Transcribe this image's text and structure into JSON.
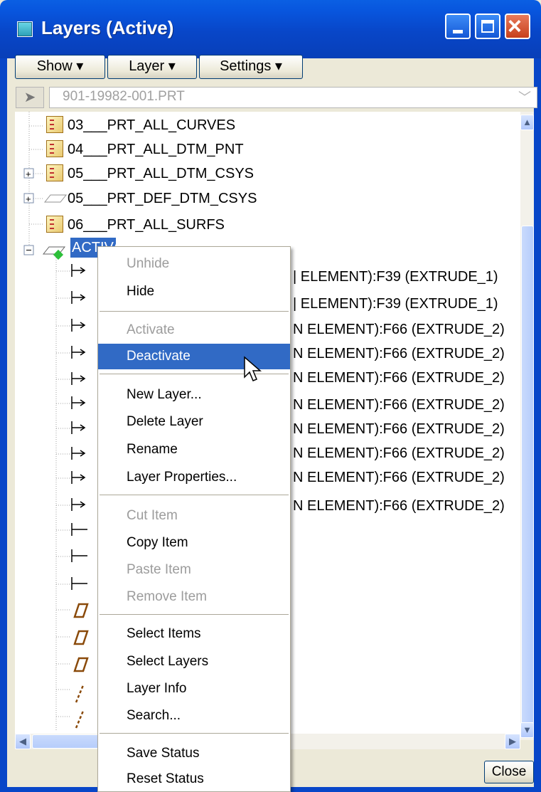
{
  "window": {
    "title": "Layers (Active)"
  },
  "menubar": {
    "show_label": "Show ▾",
    "layer_label": "Layer ▾",
    "settings_label": "Settings ▾"
  },
  "model_combo": {
    "value": "901-19982-001.PRT"
  },
  "tree": {
    "items": [
      {
        "label": "03___PRT_ALL_CURVES"
      },
      {
        "label": "04___PRT_ALL_DTM_PNT"
      },
      {
        "label": "05___PRT_ALL_DTM_CSYS"
      },
      {
        "label": "05___PRT_DEF_DTM_CSYS"
      },
      {
        "label": "06___PRT_ALL_SURFS"
      },
      {
        "label": "ACTIVATE"
      }
    ],
    "children": [
      {
        "label": "| ELEMENT):F39 (EXTRUDE_1)"
      },
      {
        "label": "| ELEMENT):F39 (EXTRUDE_1)"
      },
      {
        "label": "N ELEMENT):F66 (EXTRUDE_2)"
      },
      {
        "label": "N ELEMENT):F66 (EXTRUDE_2)"
      },
      {
        "label": "N ELEMENT):F66 (EXTRUDE_2)"
      },
      {
        "label": "N ELEMENT):F66 (EXTRUDE_2)"
      },
      {
        "label": "N ELEMENT):F66 (EXTRUDE_2)"
      },
      {
        "label": "N ELEMENT):F66 (EXTRUDE_2)"
      },
      {
        "label": "N ELEMENT):F66 (EXTRUDE_2)"
      },
      {
        "label": "N ELEMENT):F66 (EXTRUDE_2)"
      }
    ]
  },
  "context_menu": {
    "unhide": "Unhide",
    "hide": "Hide",
    "activate": "Activate",
    "deactivate": "Deactivate",
    "new_layer": "New Layer...",
    "delete_layer": "Delete Layer",
    "rename": "Rename",
    "layer_properties": "Layer Properties...",
    "cut_item": "Cut Item",
    "copy_item": "Copy Item",
    "paste_item": "Paste Item",
    "remove_item": "Remove Item",
    "select_items": "Select Items",
    "select_layers": "Select Layers",
    "layer_info": "Layer Info",
    "search": "Search...",
    "save_status": "Save Status",
    "reset_status": "Reset Status"
  },
  "footer": {
    "close_label": "Close"
  },
  "colors": {
    "titlebar": "#0846C8",
    "selection": "#316AC5",
    "face": "#ECE9D8"
  }
}
